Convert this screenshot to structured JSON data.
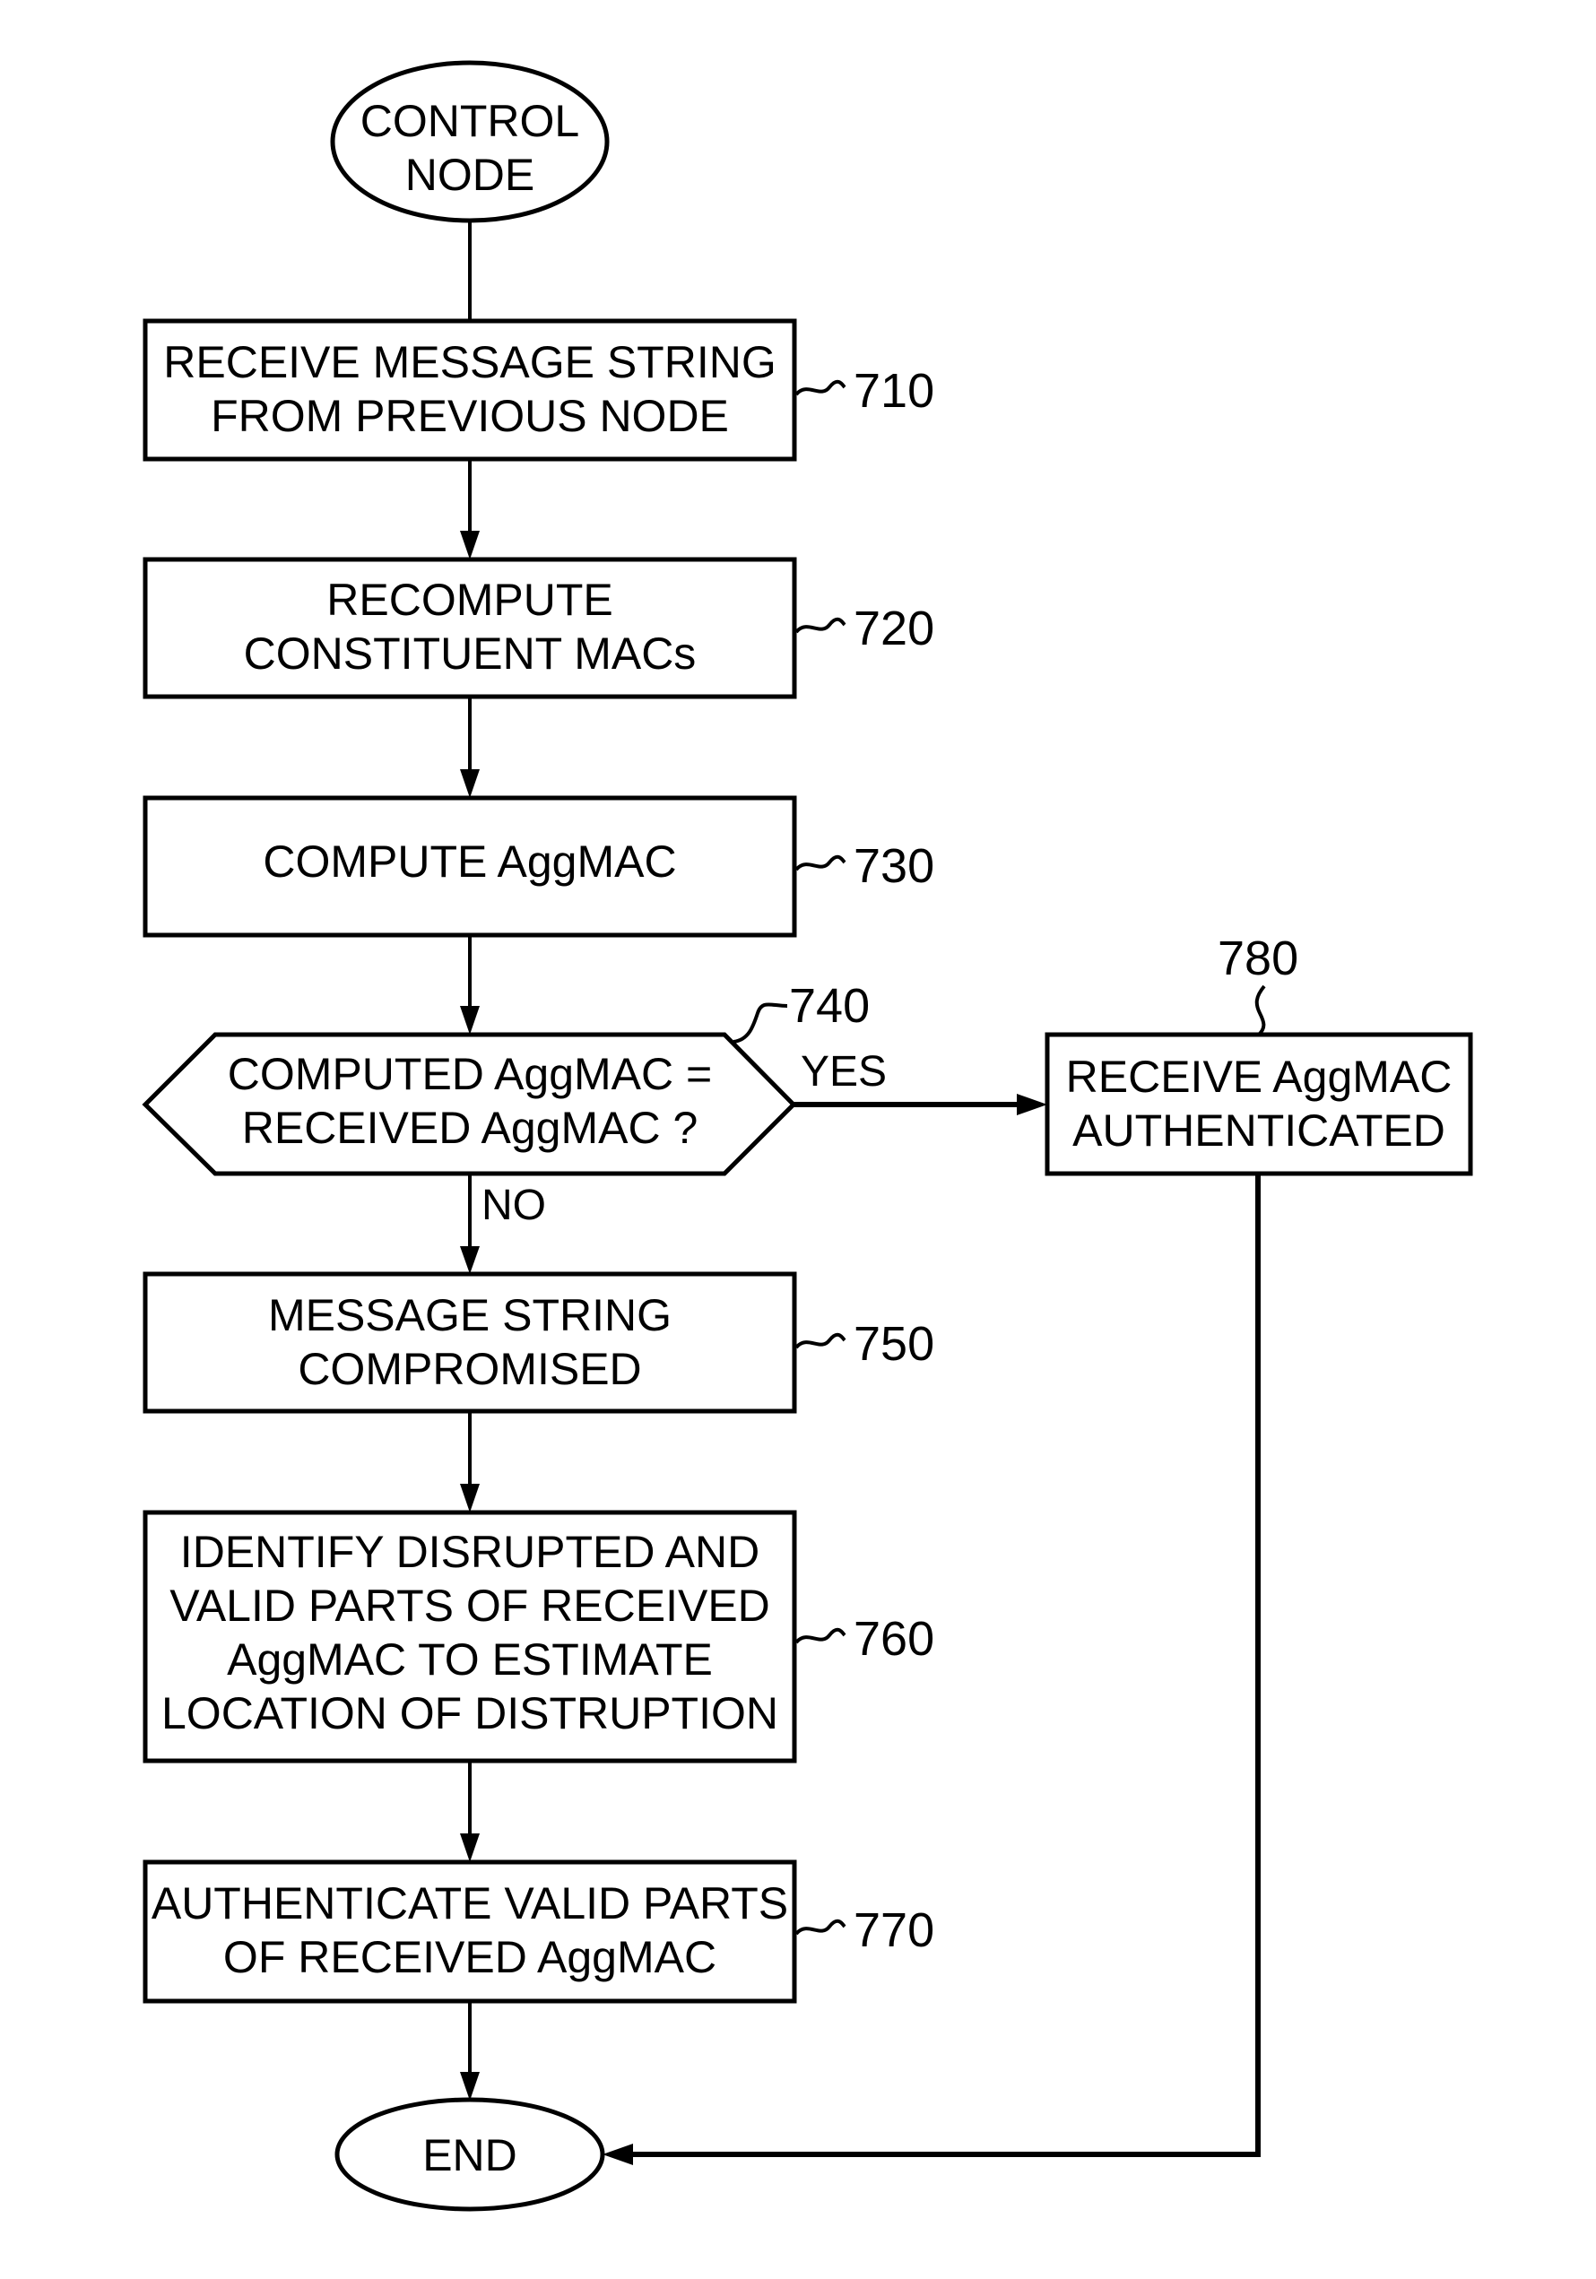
{
  "diagram": {
    "type": "flowchart",
    "start": {
      "id": "start",
      "label_lines": [
        "CONTROL",
        "NODE"
      ]
    },
    "end": {
      "id": "end",
      "label_lines": [
        "END"
      ]
    },
    "steps": [
      {
        "id": "710",
        "ref": "710",
        "label_lines": [
          "RECEIVE MESSAGE STRING",
          "FROM PREVIOUS NODE"
        ]
      },
      {
        "id": "720",
        "ref": "720",
        "label_lines": [
          "RECOMPUTE",
          "CONSTITUENT MACs"
        ]
      },
      {
        "id": "730",
        "ref": "730",
        "label_lines": [
          "COMPUTE AggMAC"
        ]
      },
      {
        "id": "740",
        "ref": "740",
        "kind": "decision",
        "label_lines": [
          "COMPUTED AggMAC =",
          "RECEIVED AggMAC ?"
        ]
      },
      {
        "id": "750",
        "ref": "750",
        "label_lines": [
          "MESSAGE STRING",
          "COMPROMISED"
        ]
      },
      {
        "id": "760",
        "ref": "760",
        "label_lines": [
          "IDENTIFY DISRUPTED AND",
          "VALID PARTS OF RECEIVED",
          "AggMAC TO ESTIMATE",
          "LOCATION OF DISTRUPTION"
        ]
      },
      {
        "id": "770",
        "ref": "770",
        "label_lines": [
          "AUTHENTICATE VALID PARTS",
          "OF RECEIVED AggMAC"
        ]
      },
      {
        "id": "780",
        "ref": "780",
        "label_lines": [
          "RECEIVE AggMAC",
          "AUTHENTICATED"
        ]
      }
    ],
    "branches": {
      "yes": "YES",
      "no": "NO"
    },
    "edges": [
      {
        "from": "start",
        "to": "710"
      },
      {
        "from": "710",
        "to": "720"
      },
      {
        "from": "720",
        "to": "730"
      },
      {
        "from": "730",
        "to": "740"
      },
      {
        "from": "740",
        "to": "780",
        "label": "YES"
      },
      {
        "from": "740",
        "to": "750",
        "label": "NO"
      },
      {
        "from": "750",
        "to": "760"
      },
      {
        "from": "760",
        "to": "770"
      },
      {
        "from": "770",
        "to": "end"
      },
      {
        "from": "780",
        "to": "end"
      }
    ]
  }
}
